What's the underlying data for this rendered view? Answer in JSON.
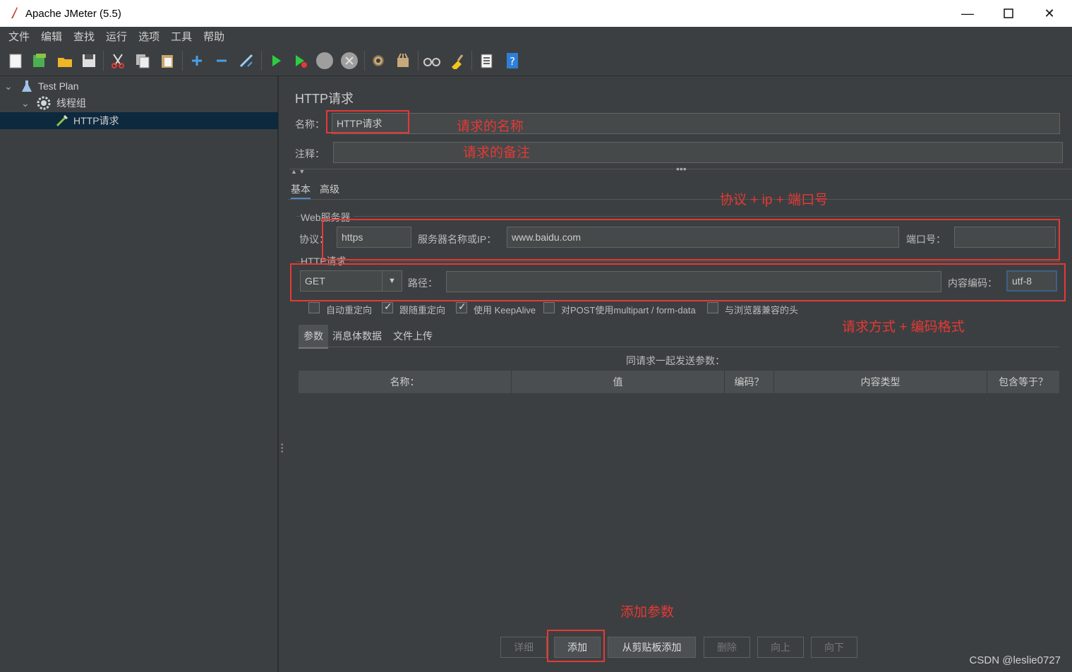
{
  "window": {
    "title": "Apache JMeter (5.5)"
  },
  "menu": [
    "文件",
    "编辑",
    "查找",
    "运行",
    "选项",
    "工具",
    "帮助"
  ],
  "toolbar_icons": [
    "new-icon",
    "templates-icon",
    "open-icon",
    "save-icon",
    "cut-icon",
    "copy-icon",
    "paste-icon",
    "expand-icon",
    "collapse-icon",
    "toggle-icon",
    "start-icon",
    "start-no-pause-icon",
    "stop-icon",
    "shutdown-icon",
    "clear-icon",
    "clear-all-icon",
    "search-icon",
    "reset-search-icon",
    "function-helper-icon",
    "help-icon"
  ],
  "tree": {
    "items": [
      {
        "label": "Test Plan",
        "icon": "flask-icon"
      },
      {
        "label": "线程组",
        "icon": "gear-icon"
      },
      {
        "label": "HTTP请求",
        "icon": "pipette-icon"
      }
    ]
  },
  "form": {
    "title": "HTTP请求",
    "name_label": "名称：",
    "name_value": "HTTP请求",
    "comment_label": "注释：",
    "comment_value": "",
    "tabs": [
      "基本",
      "高级"
    ],
    "web_server_group": "Web服务器",
    "protocol_label": "协议：",
    "protocol_value": "https",
    "server_label": "服务器名称或IP：",
    "server_value": "www.baidu.com",
    "port_label": "端口号：",
    "port_value": "",
    "http_request_group": "HTTP请求",
    "method_value": "GET",
    "path_label": "路径：",
    "path_value": "",
    "encoding_label": "内容编码：",
    "encoding_value": "utf-8",
    "checkboxes": [
      {
        "label": "自动重定向",
        "checked": false
      },
      {
        "label": "跟随重定向",
        "checked": true
      },
      {
        "label": "使用 KeepAlive",
        "checked": true
      },
      {
        "label": "对POST使用multipart / form-data",
        "checked": false
      },
      {
        "label": "与浏览器兼容的头",
        "checked": false
      }
    ],
    "subtabs": [
      "参数",
      "消息体数据",
      "文件上传"
    ],
    "params_caption": "同请求一起发送参数：",
    "columns": [
      "名称：",
      "值",
      "编码？",
      "内容类型",
      "包含等于？"
    ],
    "buttons": [
      {
        "label": "详细",
        "enabled": false
      },
      {
        "label": "添加",
        "enabled": true
      },
      {
        "label": "从剪贴板添加",
        "enabled": true
      },
      {
        "label": "删除",
        "enabled": false
      },
      {
        "label": "向上",
        "enabled": false
      },
      {
        "label": "向下",
        "enabled": false
      }
    ]
  },
  "annotations": {
    "name": "请求的名称",
    "comment": "请求的备注",
    "server": "协议 + ip + 端口号",
    "method": "请求方式 + 编码格式",
    "add": "添加参数"
  },
  "watermark": "CSDN @leslie0727",
  "colors": {
    "annotation": "#e53935",
    "accent": "#4a88c7",
    "selection": "#0d293e"
  }
}
